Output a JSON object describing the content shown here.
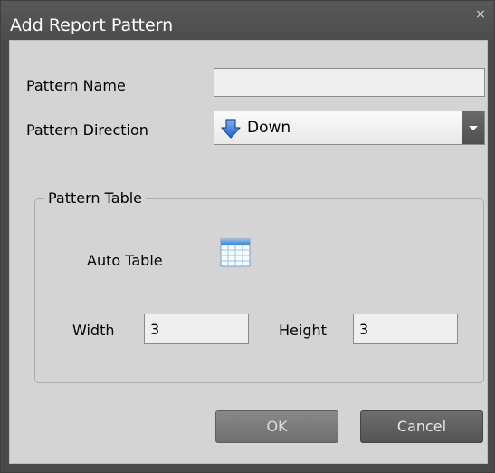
{
  "dialog": {
    "title": "Add Report Pattern",
    "close_glyph": "×"
  },
  "form": {
    "pattern_name_label": "Pattern Name",
    "pattern_name_value": "",
    "pattern_direction_label": "Pattern Direction",
    "pattern_direction_value": "Down",
    "pattern_direction_icon": "arrow-down-icon"
  },
  "pattern_table": {
    "legend": "Pattern Table",
    "auto_table_label": "Auto Table",
    "auto_table_icon": "table-grid-icon",
    "width_label": "Width",
    "width_value": "3",
    "height_label": "Height",
    "height_value": "3"
  },
  "buttons": {
    "ok_label": "OK",
    "cancel_label": "Cancel"
  },
  "colors": {
    "titlebar": "#4d4d4d",
    "client_background": "#d4d4d4",
    "arrow_icon": "#2f6fd0"
  }
}
